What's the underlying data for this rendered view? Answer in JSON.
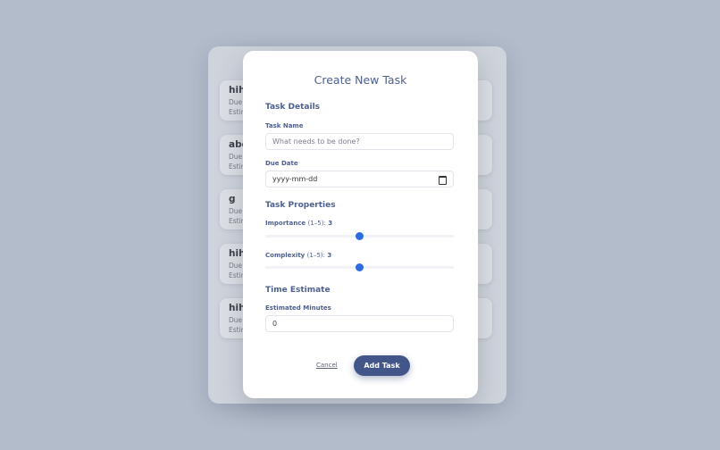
{
  "background": {
    "tasks": [
      {
        "title": "hihi",
        "due_label": "Due",
        "est_label": "Estim"
      },
      {
        "title": "abc",
        "due_label": "Due",
        "est_label": "Estim"
      },
      {
        "title": "g",
        "due_label": "Due",
        "est_label": "Estim"
      },
      {
        "title": "hihi",
        "due_label": "Due",
        "est_label": "Estim"
      },
      {
        "title": "hihi",
        "due_label": "Due",
        "est_label": "Estim"
      }
    ]
  },
  "modal": {
    "title": "Create New Task",
    "sections": {
      "details": "Task Details",
      "properties": "Task Properties",
      "time": "Time Estimate"
    },
    "task_name": {
      "label": "Task Name",
      "placeholder": "What needs to be done?",
      "value": ""
    },
    "due_date": {
      "label": "Due Date",
      "placeholder": "yyyy-mm-dd"
    },
    "importance": {
      "label": "Importance",
      "range": "(1–5):",
      "value": "3",
      "min": 1,
      "max": 5,
      "level": 3
    },
    "complexity": {
      "label": "Complexity",
      "range": "(1–5):",
      "value": "3",
      "min": 1,
      "max": 5,
      "level": 3
    },
    "estimated_minutes": {
      "label": "Estimated Minutes",
      "value": "0"
    },
    "cancel_label": "Cancel",
    "submit_label": "Add Task"
  },
  "colors": {
    "accent": "#43568a",
    "slider": "#2d6ce0",
    "heading": "#4d5f8f"
  },
  "icons": {
    "date_picker": "calendar-icon"
  }
}
